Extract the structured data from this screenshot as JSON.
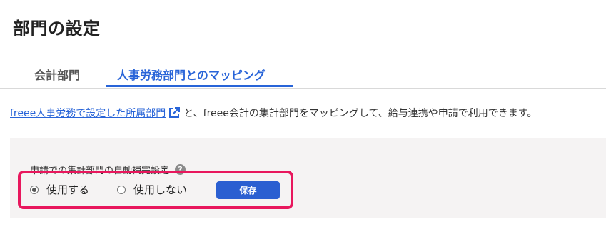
{
  "page": {
    "title": "部門の設定"
  },
  "tabs": [
    {
      "label": "会計部門",
      "active": false
    },
    {
      "label": "人事労務部門とのマッピング",
      "active": true
    }
  ],
  "description": {
    "link_text": "freee人事労務で設定した所属部門",
    "link_icon": "external-link-icon",
    "text": "と、freee会計の集計部門をマッピングして、給与連携や申請で利用できます。"
  },
  "setting": {
    "label": "申請での集計部門の自動補完設定",
    "help_icon": "question-circle-icon",
    "options": [
      {
        "label": "使用する",
        "checked": true
      },
      {
        "label": "使用しない",
        "checked": false
      }
    ],
    "save_label": "保存"
  },
  "colors": {
    "accent": "#2864d8",
    "button": "#2b5fd1",
    "highlight": "#e8175d",
    "panel_bg": "#f5f3f3"
  }
}
